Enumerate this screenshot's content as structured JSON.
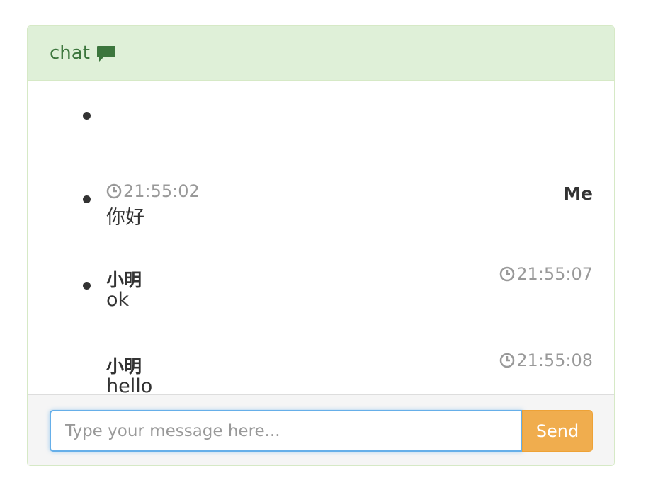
{
  "panel": {
    "title": "chat",
    "title_icon": "comment-icon",
    "accent_color": "#3c763d",
    "header_bg": "#dff0d8"
  },
  "messages": [
    {
      "sender": "Me",
      "time": "21:55:02",
      "text": "你好",
      "is_self": true
    },
    {
      "sender": "小明",
      "time": "21:55:07",
      "text": "ok",
      "is_self": false
    },
    {
      "sender": "小明",
      "time": "21:55:08",
      "text": "hello",
      "is_self": false
    }
  ],
  "composer": {
    "placeholder": "Type your message here...",
    "value": "",
    "send_label": "Send",
    "send_color": "#f0ad4e"
  }
}
